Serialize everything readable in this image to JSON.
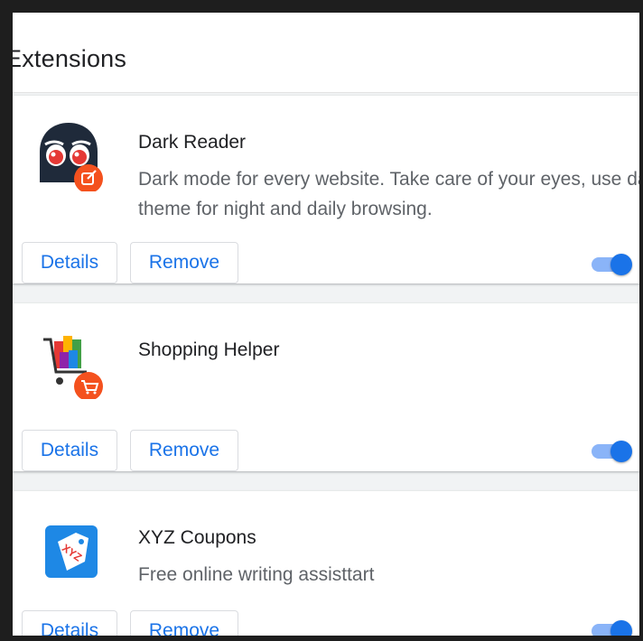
{
  "page": {
    "title": "Extensions"
  },
  "extensions": [
    {
      "name": "Dark Reader",
      "description": "Dark mode for every website. Take care of your  eyes, use dark theme for night and daily browsing.",
      "details_label": "Details",
      "remove_label": "Remove",
      "enabled": true,
      "icon": "dark-reader-icon"
    },
    {
      "name": "Shopping Helper",
      "description": "",
      "details_label": "Details",
      "remove_label": "Remove",
      "enabled": true,
      "icon": "shopping-cart-icon"
    },
    {
      "name": "XYZ Coupons",
      "description": "Free online writing assisttart",
      "details_label": "Details",
      "remove_label": "Remove",
      "enabled": true,
      "icon": "coupon-tag-icon"
    }
  ],
  "colors": {
    "accent": "#1a73e8",
    "toggle_track": "#8ab4f8",
    "badge_orange": "#f4511e"
  }
}
